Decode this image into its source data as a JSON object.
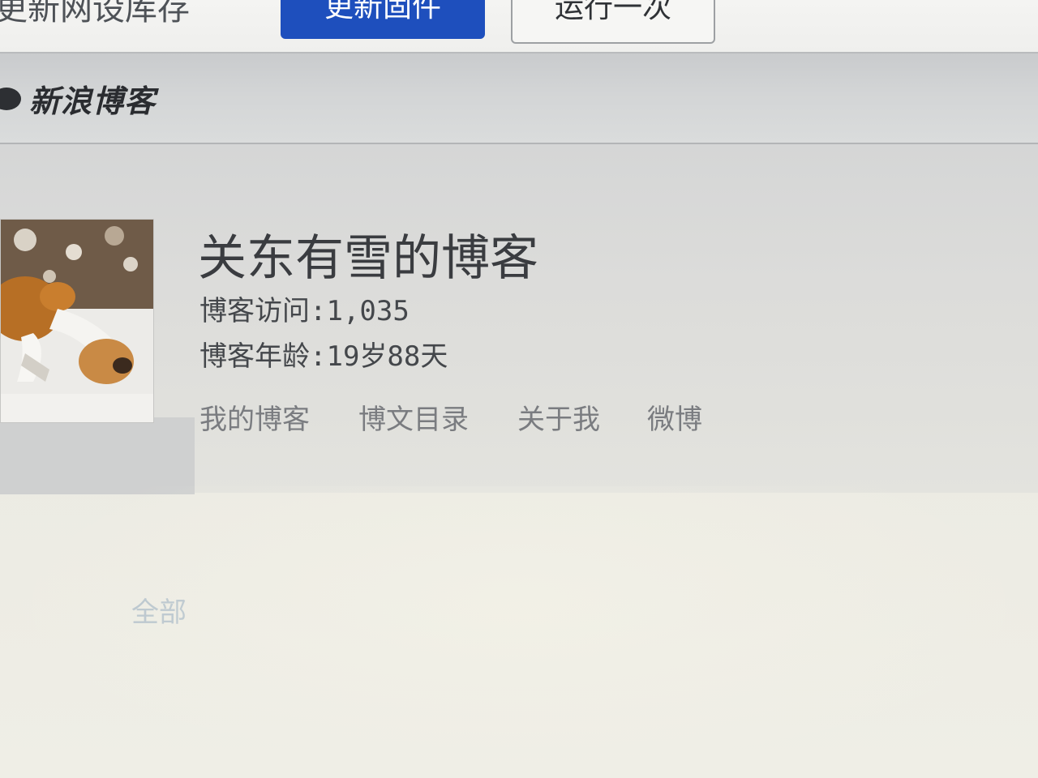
{
  "toolbar": {
    "partial_text": "更新网设库存",
    "primary_button_label": "更新固件",
    "secondary_button_label": "运行一次"
  },
  "sina": {
    "brand": "新浪博客"
  },
  "profile": {
    "blog_title": "关东有雪的博客",
    "visits": "博客访问:1,035",
    "age": "博客年龄:19岁88天"
  },
  "nav": {
    "items": [
      {
        "label": "我的博客"
      },
      {
        "label": "博文目录"
      },
      {
        "label": "关于我"
      },
      {
        "label": "微博"
      }
    ]
  },
  "content": {
    "tab_all": "全部"
  },
  "colors": {
    "primary_button": "#1e4fbd",
    "link_gray": "#7a7c80",
    "tab_light_blue": "#b4c2cc"
  }
}
